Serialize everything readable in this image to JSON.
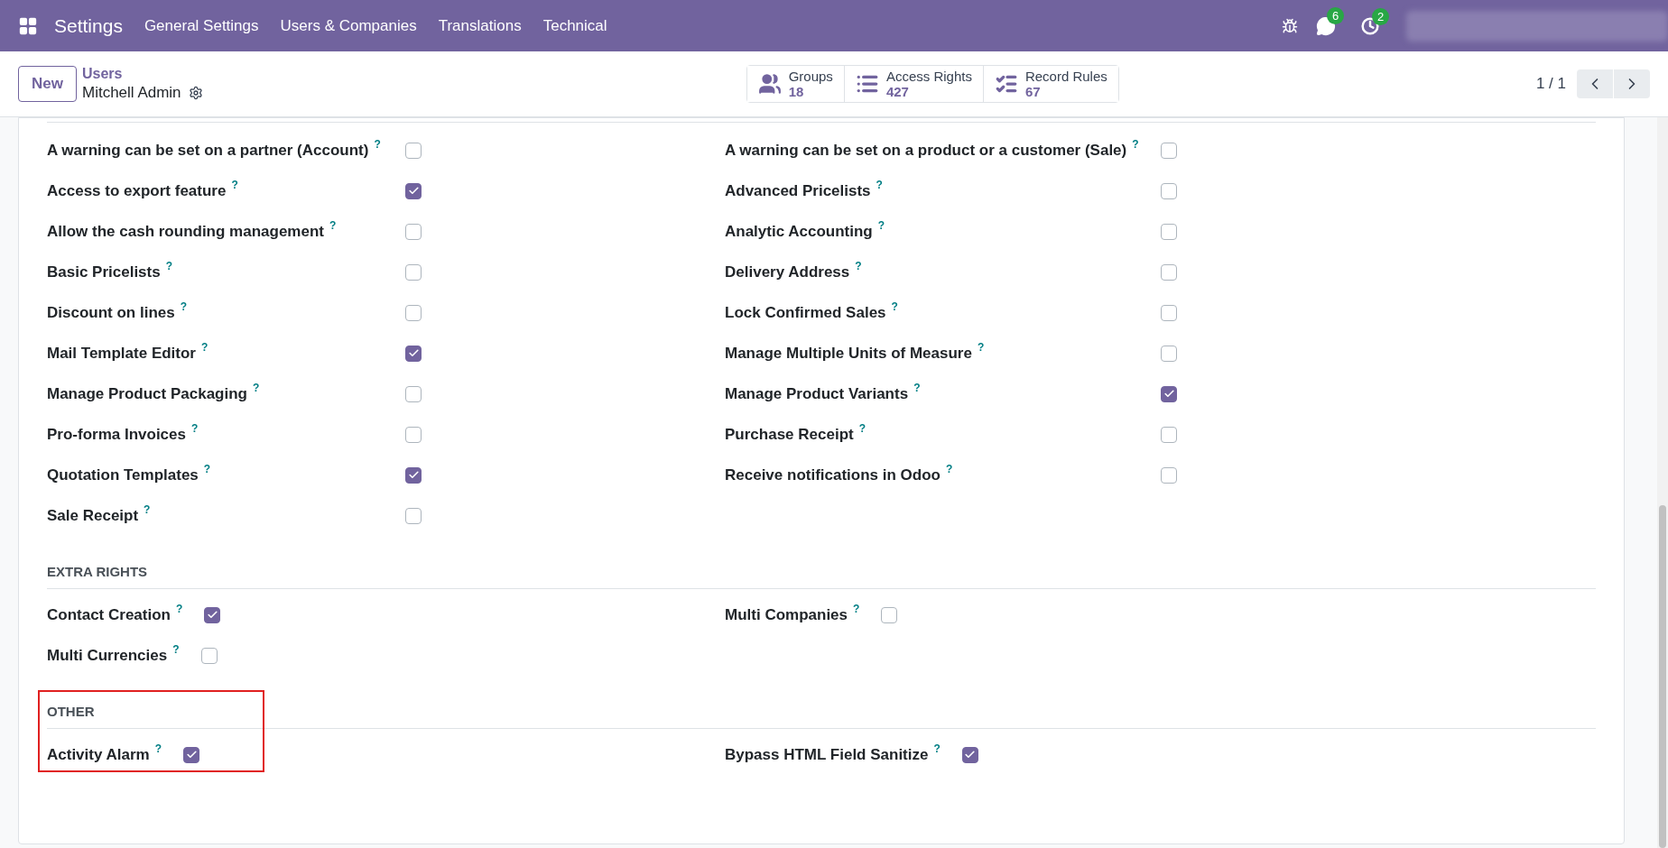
{
  "navbar": {
    "app": "Settings",
    "menu": [
      "General Settings",
      "Users & Companies",
      "Translations",
      "Technical"
    ],
    "messages_badge": "6",
    "activities_badge": "2"
  },
  "control_panel": {
    "new_button": "New",
    "breadcrumb": "Users",
    "record": "Mitchell Admin",
    "smart_buttons": [
      {
        "kind": "groups",
        "label": "Groups",
        "count": "18"
      },
      {
        "kind": "list",
        "label": "Access Rights",
        "count": "427"
      },
      {
        "kind": "rules",
        "label": "Record Rules",
        "count": "67"
      }
    ],
    "pager": "1 / 1"
  },
  "sections": [
    {
      "kind": "wide",
      "fields": [
        {
          "label": "A warning can be set on a partner (Account)",
          "help": "?",
          "checked": false
        },
        {
          "label": "A warning can be set on a product or a customer (Sale)",
          "help": "?",
          "checked": false
        },
        {
          "label": "Access to export feature",
          "help": "?",
          "checked": true
        },
        {
          "label": "Advanced Pricelists",
          "help": "?",
          "checked": false
        },
        {
          "label": "Allow the cash rounding management",
          "help": "?",
          "checked": false
        },
        {
          "label": "Analytic Accounting",
          "help": "?",
          "checked": false
        },
        {
          "label": "Basic Pricelists",
          "help": "?",
          "checked": false
        },
        {
          "label": "Delivery Address",
          "help": "?",
          "checked": false
        },
        {
          "label": "Discount on lines",
          "help": "?",
          "checked": false
        },
        {
          "label": "Lock Confirmed Sales",
          "help": "?",
          "checked": false
        },
        {
          "label": "Mail Template Editor",
          "help": "?",
          "checked": true
        },
        {
          "label": "Manage Multiple Units of Measure",
          "help": "?",
          "checked": false
        },
        {
          "label": "Manage Product Packaging",
          "help": "?",
          "checked": false
        },
        {
          "label": "Manage Product Variants",
          "help": "?",
          "checked": true
        },
        {
          "label": "Pro-forma Invoices",
          "help": "?",
          "checked": false
        },
        {
          "label": "Purchase Receipt",
          "help": "?",
          "checked": false
        },
        {
          "label": "Quotation Templates",
          "help": "?",
          "checked": true
        },
        {
          "label": "Receive notifications in Odoo",
          "help": "?",
          "checked": false
        },
        {
          "label": "Sale Receipt",
          "help": "?",
          "checked": false
        }
      ]
    },
    {
      "kind": "compact",
      "title": "EXTRA RIGHTS",
      "fields": [
        {
          "label": "Contact Creation",
          "help": "?",
          "checked": true
        },
        {
          "label": "Multi Companies",
          "help": "?",
          "checked": false
        },
        {
          "label": "Multi Currencies",
          "help": "?",
          "checked": false
        }
      ]
    },
    {
      "kind": "compact",
      "title": "OTHER",
      "highlighted": true,
      "fields": [
        {
          "label": "Activity Alarm",
          "help": "?",
          "checked": true
        },
        {
          "label": "Bypass HTML Field Sanitize",
          "help": "?",
          "checked": true
        }
      ]
    }
  ]
}
